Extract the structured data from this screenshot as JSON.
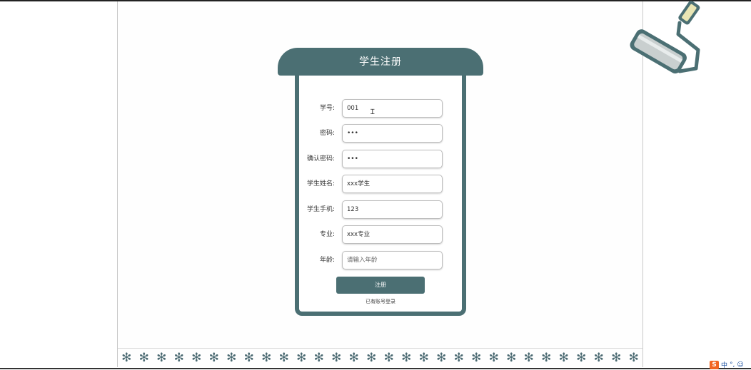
{
  "form": {
    "title": "学生注册",
    "fields": [
      {
        "label": "学号:",
        "value": "001"
      },
      {
        "label": "密码:",
        "value": "•••"
      },
      {
        "label": "确认密码:",
        "value": "•••"
      },
      {
        "label": "学生姓名:",
        "value": "xxx学生"
      },
      {
        "label": "学生手机:",
        "value": "123"
      },
      {
        "label": "专业:",
        "value": "xxx专业"
      },
      {
        "label": "年龄:",
        "placeholder": "请输入年龄"
      }
    ],
    "submit_label": "注册",
    "login_link": "已有账号登录"
  },
  "decor": {
    "snowflake": "✻",
    "roller_icon": "paint-roller-icon"
  },
  "ime": {
    "logo": "S",
    "lang": "中",
    "punct": "°,",
    "emoji": "☺"
  },
  "colors": {
    "accent": "#4b6f73"
  }
}
